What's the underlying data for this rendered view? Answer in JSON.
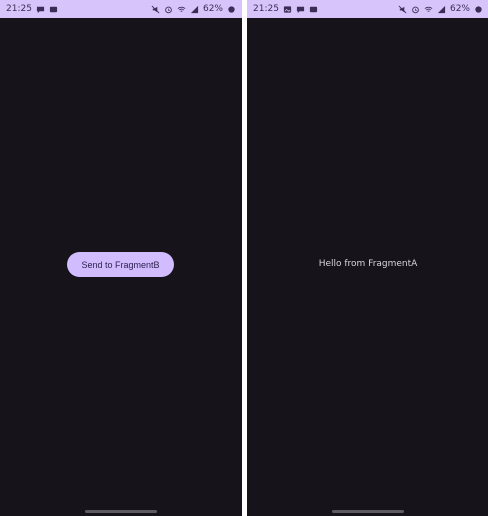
{
  "colors": {
    "statusbar_bg": "#d7c4fb",
    "screen_bg": "#16131b",
    "button_bg": "#d0bcff",
    "button_text": "#2b1f48",
    "hello_text": "#d7d5dc"
  },
  "left_phone": {
    "status": {
      "time": "21:25",
      "battery": "62%",
      "icons": [
        "message-icon",
        "notification-icon",
        "mute-icon",
        "alarm-icon",
        "wifi-icon",
        "signal-icon",
        "battery-icon"
      ]
    },
    "button_label": "Send to FragmentB"
  },
  "right_phone": {
    "status": {
      "time": "21:25",
      "battery": "62%",
      "icons": [
        "image-icon",
        "message-icon",
        "notification-icon",
        "mute-icon",
        "alarm-icon",
        "wifi-icon",
        "signal-icon",
        "battery-icon"
      ]
    },
    "message_text": "Hello from FragmentA"
  }
}
